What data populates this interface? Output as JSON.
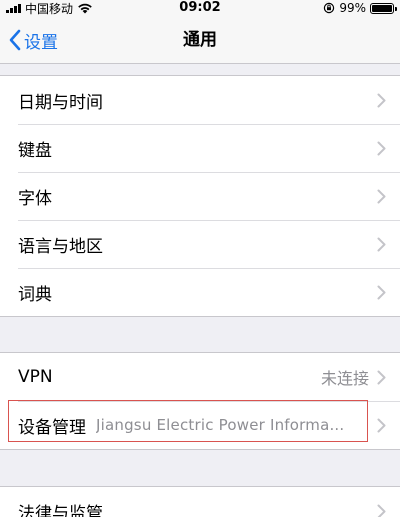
{
  "status_bar": {
    "carrier": "中国移动",
    "time": "09:02",
    "battery": "99%",
    "battery_level": 0.99,
    "icons": [
      "signal-icon",
      "wifi-icon",
      "rotation-lock-icon",
      "battery-icon"
    ]
  },
  "nav": {
    "back_label": "设置",
    "title": "通用",
    "accent_color": "#1a73e8"
  },
  "groups": [
    {
      "items": [
        {
          "label": "日期与时间"
        },
        {
          "label": "键盘"
        },
        {
          "label": "字体"
        },
        {
          "label": "语言与地区"
        },
        {
          "label": "词典"
        }
      ]
    },
    {
      "items": [
        {
          "label": "VPN",
          "value": "未连接"
        },
        {
          "label": "设备管理",
          "value": "Jiangsu Electric Power Informa..."
        }
      ]
    },
    {
      "items": [
        {
          "label": "法律与监管"
        }
      ]
    }
  ],
  "highlight_color": "#d9534f"
}
